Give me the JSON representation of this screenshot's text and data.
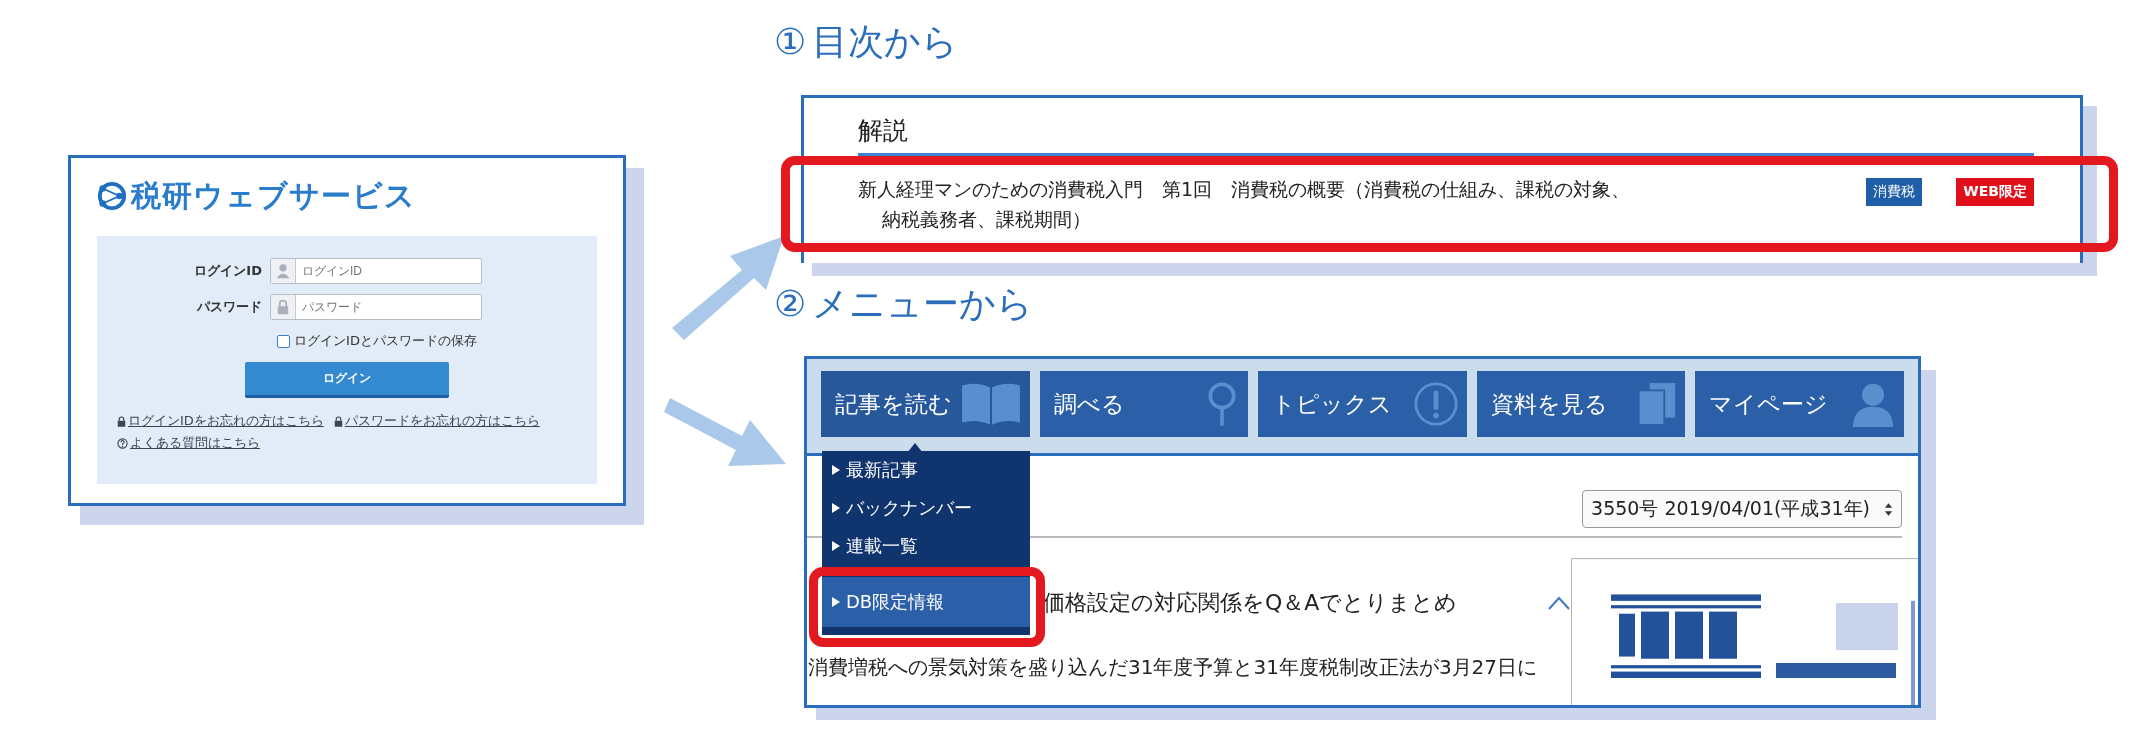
{
  "login_panel": {
    "logo": "税研ウェブサービス",
    "fields": [
      {
        "label": "ログインID",
        "placeholder": "ログインID",
        "kind": "user"
      },
      {
        "label": "パスワード",
        "placeholder": "パスワード",
        "kind": "lock"
      }
    ],
    "remember": {
      "label": "ログインIDとパスワードの保存",
      "checked": false
    },
    "button": "ログイン",
    "links": [
      {
        "text": "ログインIDをお忘れの方はこちら",
        "kind": "lock"
      },
      {
        "text": "パスワードをお忘れの方はこちら",
        "kind": "lock"
      },
      {
        "text": "よくある質問はこちら",
        "kind": "help"
      }
    ]
  },
  "steps": [
    {
      "number": "①",
      "title": "目次から"
    },
    {
      "number": "②",
      "title": "メニューから"
    }
  ],
  "toc_panel": {
    "heading": "解説",
    "article": {
      "lines": [
        "新人経理マンのための消費税入門　第1回　消費税の概要（消費税の仕組み、課税の対象、",
        "納税義務者、課税期間）"
      ],
      "tags": [
        {
          "text": "消費税",
          "color": "#1f5ea8"
        },
        {
          "text": "WEB限定",
          "color": "#e0101a"
        }
      ]
    }
  },
  "menu_panel": {
    "tabs": [
      {
        "label": "記事を読む",
        "kind": "book",
        "selected": true
      },
      {
        "label": "調べる",
        "kind": "search",
        "selected": false
      },
      {
        "label": "トピックス",
        "kind": "alert",
        "selected": false
      },
      {
        "label": "資料を見る",
        "kind": "documents",
        "selected": false
      },
      {
        "label": "マイページ",
        "kind": "person",
        "selected": false
      }
    ],
    "dropdown": [
      {
        "label": "最新記事",
        "selected": false
      },
      {
        "label": "バックナンバー",
        "selected": false
      },
      {
        "label": "連載一覧",
        "selected": false
      },
      {
        "label": "DB限定情報",
        "selected": true
      }
    ],
    "issue_select": "3550号 2019/04/01(平成31年)",
    "article": {
      "title": "価格設定の対応関係をQ＆Aでとりまとめ",
      "summary": "消費増税への景気対策を盛り込んだ31年度予算と31年度税制改正法が3月27日に"
    }
  }
}
